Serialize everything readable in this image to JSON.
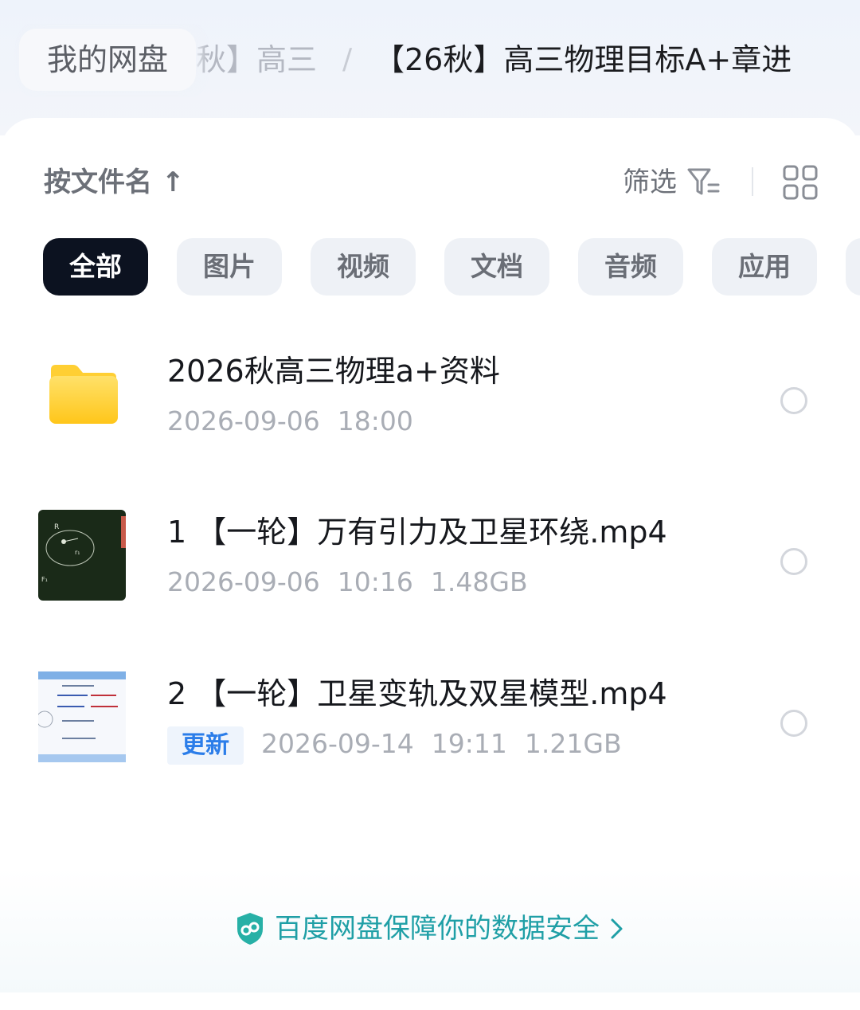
{
  "breadcrumb": {
    "root": "我的网盘",
    "middle": "秋】高三",
    "separator": "/",
    "current": "【26秋】高三物理目标A+章进"
  },
  "toolbar": {
    "sort_label": "按文件名 ↑",
    "filter_label": "筛选",
    "filter_icon": "filter-icon",
    "view_icon": "grid-view-icon"
  },
  "chips": [
    {
      "label": "全部",
      "active": true
    },
    {
      "label": "图片",
      "active": false
    },
    {
      "label": "视频",
      "active": false
    },
    {
      "label": "文档",
      "active": false
    },
    {
      "label": "音频",
      "active": false
    },
    {
      "label": "应用",
      "active": false
    }
  ],
  "files": [
    {
      "name": "2026秋高三物理a+资料",
      "date": "2026-09-06",
      "time": "18:00",
      "size": "",
      "badge": "",
      "type": "folder"
    },
    {
      "name": "1 【一轮】万有引力及卫星环绕.mp4",
      "date": "2026-09-06",
      "time": "10:16",
      "size": "1.48GB",
      "badge": "",
      "type": "video-blackboard"
    },
    {
      "name": "2 【一轮】卫星变轨及双星模型.mp4",
      "date": "2026-09-14",
      "time": "19:11",
      "size": "1.21GB",
      "badge": "更新",
      "type": "video-slide"
    }
  ],
  "footer": {
    "security_text": "百度网盘保障你的数据安全",
    "shield_icon": "shield-icon",
    "chevron_icon": "chevron-right-icon"
  },
  "colors": {
    "accent_teal": "#1f9fa6",
    "chip_active_bg": "#0c1220",
    "badge_blue": "#2b7de9",
    "folder_yellow": "#ffd43b"
  }
}
